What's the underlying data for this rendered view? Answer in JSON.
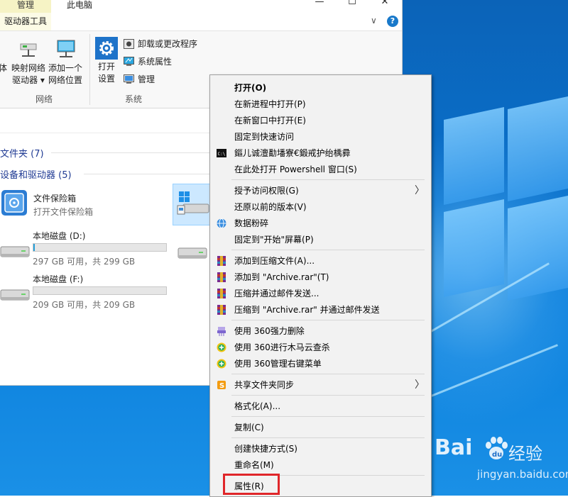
{
  "window": {
    "title": "此电脑",
    "manage_tab": "管理",
    "drive_tools_tab": "驱动器工具",
    "minimize": "—",
    "maximize": "☐",
    "close": "✕",
    "ribbon_collapse": "∨",
    "help": "?"
  },
  "ribbon": {
    "network_group": {
      "label": "网络",
      "partial_button": "体",
      "map_drive": [
        "映射网络",
        "驱动器 ▾"
      ],
      "add_location": [
        "添加一个",
        "网络位置"
      ]
    },
    "system_group": {
      "label": "系统",
      "open_settings": [
        "打开",
        "设置"
      ],
      "uninstall": "卸载或更改程序",
      "system_properties": "系统属性",
      "manage": "管理"
    }
  },
  "content": {
    "folders_section": "文件夹 (7)",
    "devices_section": "设备和驱动器 (5)",
    "vault": {
      "title": "文件保险箱",
      "subtitle": "打开文件保险箱"
    },
    "drive_d": {
      "title": "本地磁盘 (D:)",
      "space": "297 GB 可用，共 299 GB",
      "used_fraction": 0.01
    },
    "drive_f": {
      "title": "本地磁盘 (F:)",
      "space": "209 GB 可用，共 209 GB",
      "used_fraction": 0.0
    }
  },
  "context_menu": {
    "open": "打开(O)",
    "open_new_process": "在新进程中打开(P)",
    "open_new_window": "在新窗口中打开(E)",
    "pin_quick_access": "固定到快速访问",
    "garbled_item": "鏂儿诚澶勫墦寮€鍛戒护绐楀彛",
    "open_powershell": "在此处打开 Powershell 窗口(S)",
    "grant_access": "授予访问权限(G)",
    "restore_versions": "还原以前的版本(V)",
    "shred": "数据粉碎",
    "pin_start": "固定到\"开始\"屏幕(P)",
    "add_archive": "添加到压缩文件(A)...",
    "add_archive_rar": "添加到 \"Archive.rar\"(T)",
    "compress_email": "压缩并通过邮件发送...",
    "compress_rar_email": "压缩到 \"Archive.rar\" 并通过邮件发送",
    "del_360": "使用 360强力删除",
    "scan_360": "使用 360进行木马云查杀",
    "menu_360": "使用 360管理右键菜单",
    "share_sync": "共享文件夹同步",
    "format": "格式化(A)...",
    "copy": "复制(C)",
    "create_shortcut": "创建快捷方式(S)",
    "rename": "重命名(M)",
    "properties": "属性(R)",
    "submenu_arrow": "〉"
  },
  "watermark": {
    "brand_left": "Bai",
    "brand_right": "经验",
    "url": "jingyan.baidu.com"
  },
  "colors": {
    "accent": "#1979ca",
    "highlight_border": "#e0262a",
    "desktop_blue": "#0b70c8"
  }
}
